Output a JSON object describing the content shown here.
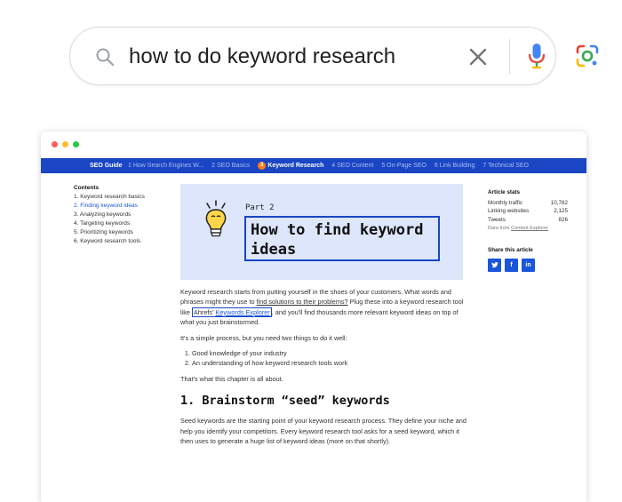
{
  "search": {
    "query": "how to do keyword research",
    "icons": [
      "search-icon",
      "clear-icon",
      "microphone-icon",
      "google-lens-icon"
    ]
  },
  "nav": {
    "brand": "SEO Guide",
    "items": [
      {
        "label": "1 How Search Engines W...",
        "active": false
      },
      {
        "label": "2 SEO Basics",
        "active": false
      },
      {
        "badge": "3",
        "label": "Keyword Research",
        "active": true
      },
      {
        "label": "4 SEO Content",
        "active": false
      },
      {
        "label": "5 On-Page SEO",
        "active": false
      },
      {
        "label": "6 Link Building",
        "active": false
      },
      {
        "label": "7 Technical SEO",
        "active": false
      }
    ]
  },
  "toc": {
    "title": "Contents",
    "items": [
      {
        "label": "1. Keyword research basics",
        "active": false
      },
      {
        "label": "2. Finding keyword ideas",
        "active": true
      },
      {
        "label": "3. Analyzing keywords",
        "active": false
      },
      {
        "label": "4. Targeting keywords",
        "active": false
      },
      {
        "label": "5. Prioritizing keywords",
        "active": false
      },
      {
        "label": "6. Keyword research tools",
        "active": false
      }
    ]
  },
  "hero": {
    "part": "Part 2",
    "title": "How to find keyword ideas"
  },
  "article": {
    "p1_a": "Keyword research starts from putting yourself in the shoes of your customers. What words and phrases might they use to ",
    "p1_underline": "find solutions to their problems?",
    "p1_b": " Plug these into a keyword research tool like ",
    "p1_link_prefix": "Ahrefs' ",
    "p1_link": "Keywords Explorer",
    "p1_c": ", and you'll find thousands more relevant keyword ideas on top of what you just brainstormed.",
    "p2": "It's a simple process, but you need two things to do it well:",
    "list": [
      "Good knowledge of your industry",
      "An understanding of how keyword research tools work"
    ],
    "p3": "That's what this chapter is all about.",
    "section_heading": "1. Brainstorm “seed” keywords",
    "p4": "Seed keywords are the starting point of your keyword research process. They define your niche and help you identify your competitors. Every keyword research tool asks for a seed keyword, which it then uses to generate a huge list of keyword ideas (more on that shortly)."
  },
  "stats": {
    "title": "Article stats",
    "rows": [
      {
        "label": "Monthly traffic",
        "value": "10,782"
      },
      {
        "label": "Linking websites",
        "value": "2,125"
      },
      {
        "label": "Tweets",
        "value": "826"
      }
    ],
    "source_prefix": "Data from ",
    "source_link": "Content Explorer"
  },
  "share": {
    "title": "Share this article",
    "buttons": [
      "🐦",
      "f",
      "in"
    ]
  },
  "colors": {
    "accent": "#1a46c4",
    "link": "#1a56db",
    "hero_bg": "#dde6fb",
    "badge": "#ff7a1a"
  }
}
